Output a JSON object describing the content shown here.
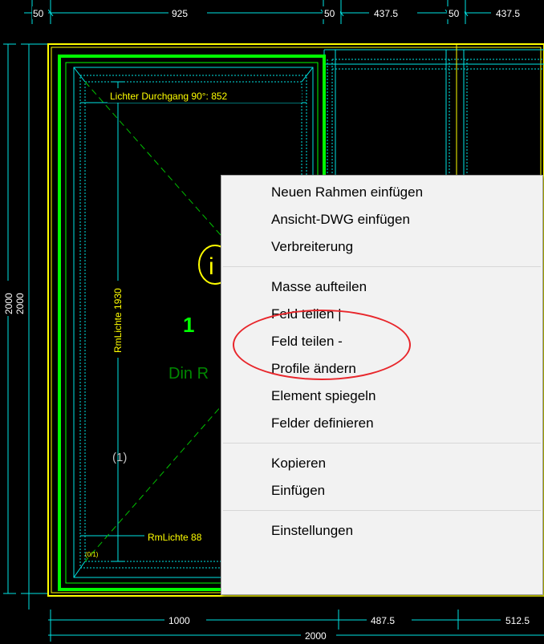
{
  "dimensions": {
    "top": [
      "50",
      "925",
      "50",
      "437.5",
      "50",
      "437.5"
    ],
    "bottom_row1": [
      "1000",
      "487.5",
      "512.5"
    ],
    "bottom_row2": "2000",
    "left": [
      "2000",
      "2000"
    ]
  },
  "drawing": {
    "clear_passage": "Lichter Durchgang 90°: 852",
    "rm_lichte_vertical": "RmLichte 1930",
    "rm_lichte_horizontal": "RmLichte 88",
    "field_number": "1",
    "din_label": "Din  R",
    "field_index": "(1)",
    "small_marker": "(0/1)",
    "info_symbol": "i"
  },
  "context_menu": {
    "groups": [
      [
        "Neuen Rahmen einfügen",
        "Ansicht-DWG einfügen",
        "Verbreiterung"
      ],
      [
        "Masse aufteilen",
        "Feld teilen |",
        "Feld teilen -",
        "Profile ändern",
        "Element spiegeln",
        "Felder definieren"
      ],
      [
        "Kopieren",
        "Einfügen"
      ],
      [
        "Einstellungen"
      ]
    ]
  },
  "colors": {
    "background": "#000000",
    "dimension_lines": "#00e5e5",
    "frame_green": "#00ff00",
    "frame_yellow": "#ffff00",
    "highlight": "#e8262b",
    "menu_bg": "#f2f2f2"
  }
}
